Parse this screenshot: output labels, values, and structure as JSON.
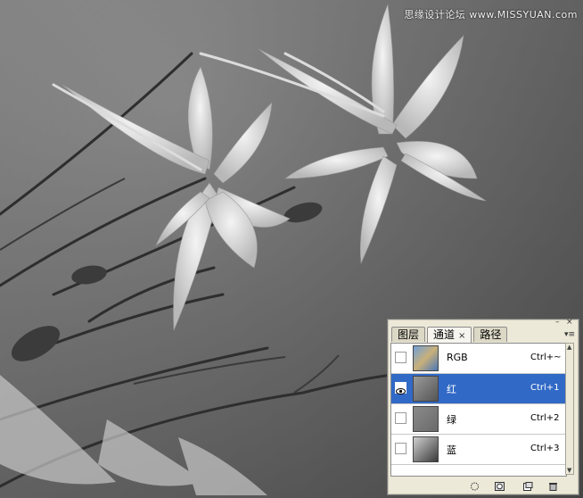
{
  "watermark": "思缘设计论坛 www.MISSYUAN.com",
  "panel": {
    "tabs": [
      {
        "label": "图层"
      },
      {
        "label": "通道",
        "close": "×"
      },
      {
        "label": "路径"
      }
    ],
    "menu_glyph": "▾≡",
    "window_controls": {
      "minimize": "–",
      "close": "×"
    },
    "channels": [
      {
        "name": "RGB",
        "shortcut": "Ctrl+~",
        "visible": false,
        "selected": false
      },
      {
        "name": "红",
        "shortcut": "Ctrl+1",
        "visible": true,
        "selected": true
      },
      {
        "name": "绿",
        "shortcut": "Ctrl+2",
        "visible": false,
        "selected": false
      },
      {
        "name": "蓝",
        "shortcut": "Ctrl+3",
        "visible": false,
        "selected": false
      }
    ],
    "bottom_icons": [
      "load-channel-as-selection-icon",
      "save-selection-as-channel-icon",
      "new-channel-icon",
      "delete-channel-icon"
    ],
    "selection_color": "#3169c6"
  }
}
